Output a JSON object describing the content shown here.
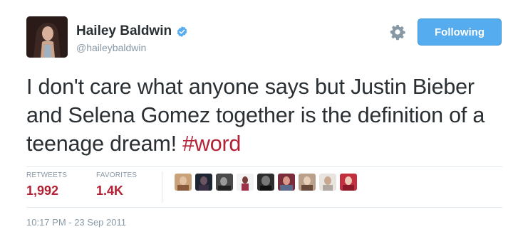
{
  "header": {
    "display_name": "Hailey Baldwin",
    "handle": "@haileybaldwin",
    "follow_label": "Following"
  },
  "tweet": {
    "text_main": "I don't care what anyone says but Justin Bieber and Selena Gomez together is the definition of a teenage dream! ",
    "hashtag": "#word"
  },
  "stats": {
    "retweets_label": "RETWEETS",
    "retweets_value": "1,992",
    "favorites_label": "FAVORITES",
    "favorites_value": "1.4K"
  },
  "favoriters_icons": [
    "user-avatar-1",
    "user-avatar-2",
    "user-avatar-3",
    "user-avatar-4",
    "user-avatar-5",
    "user-avatar-6",
    "user-avatar-7",
    "user-avatar-8",
    "user-avatar-9"
  ],
  "timestamp": "10:17 PM - 23 Sep 2011",
  "colors": {
    "accent_blue": "#55acee",
    "hashtag_red": "#b22234",
    "stat_red": "#b22234",
    "muted_gray": "#8899a6"
  }
}
